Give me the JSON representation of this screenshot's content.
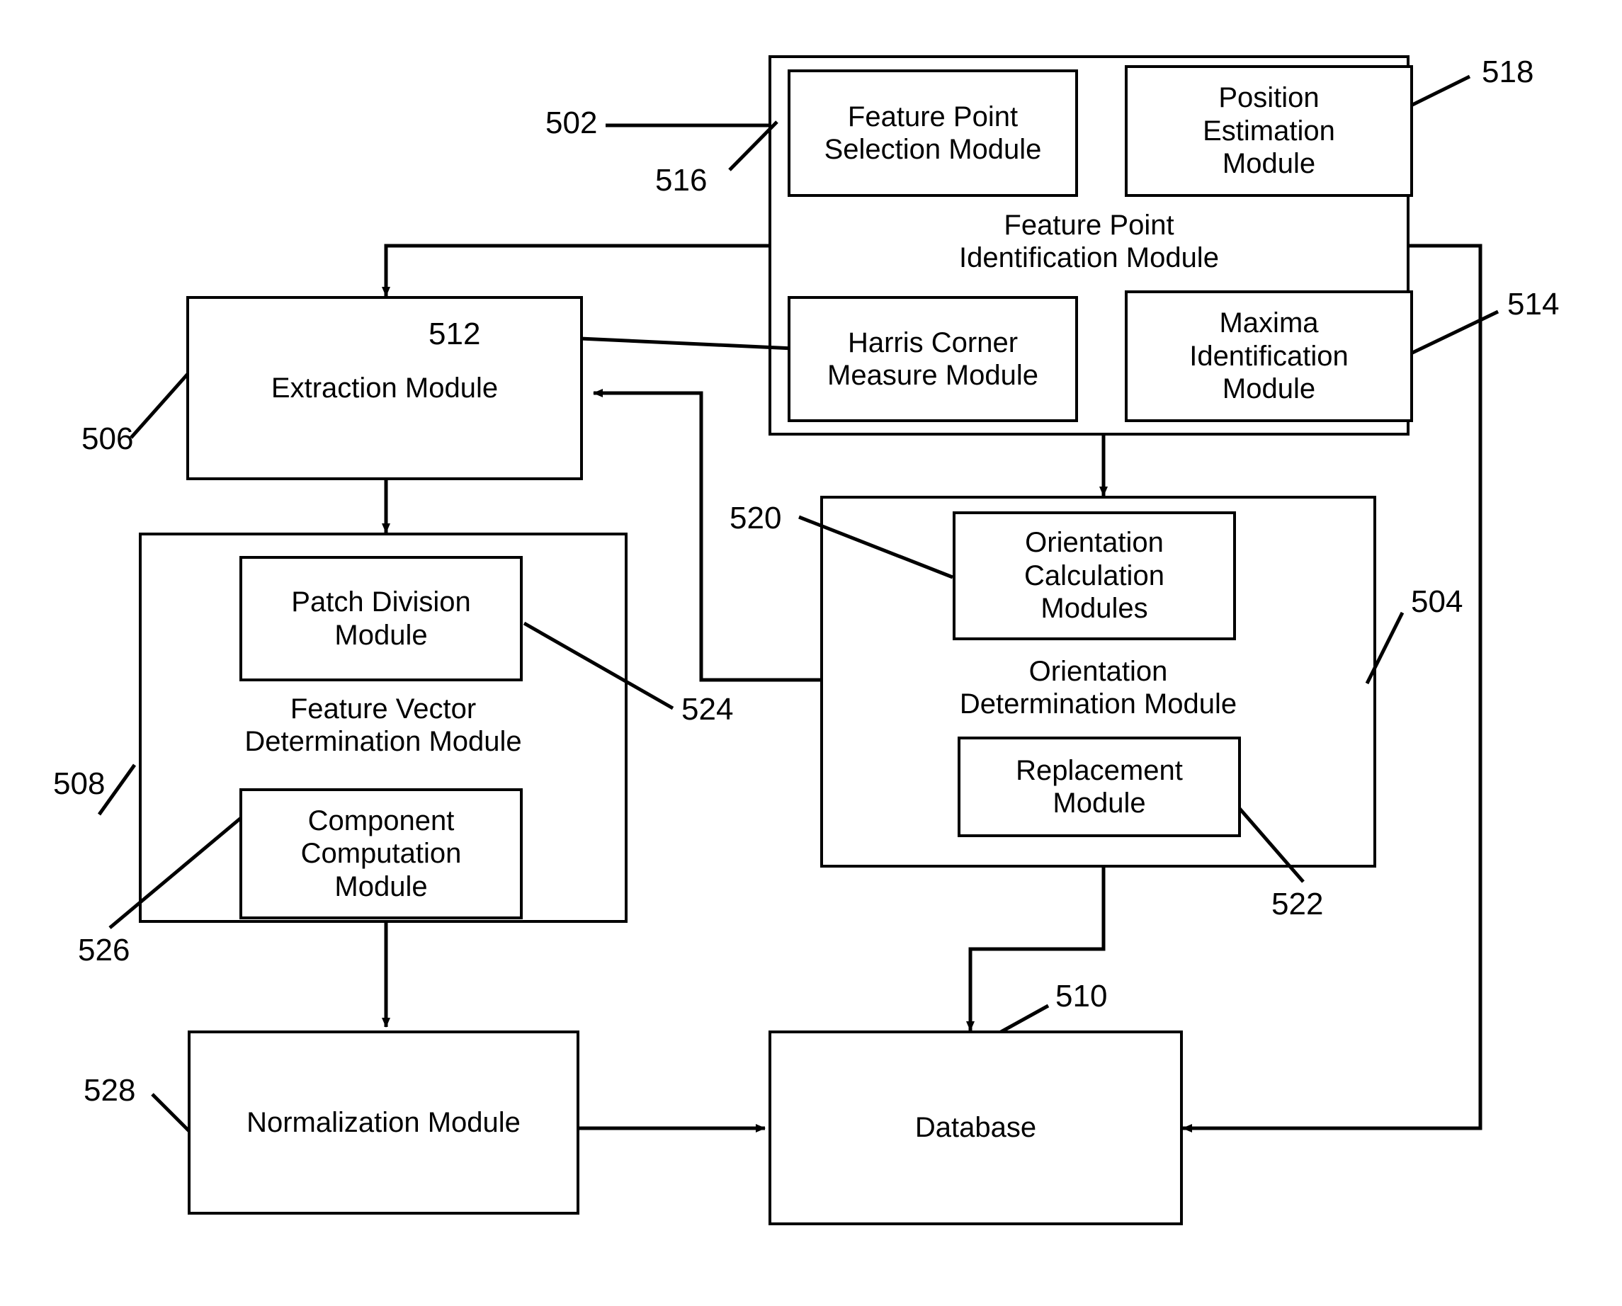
{
  "figure": {
    "kind": "patent-block-diagram",
    "background": "#ffffff",
    "stroke": "#000000"
  },
  "containers": {
    "feature_point_identification": {
      "label": "Feature Point\nIdentification Module",
      "ref": "502"
    },
    "feature_vector_determination": {
      "label": "Feature Vector\nDetermination Module",
      "ref": "508"
    },
    "orientation_determination": {
      "label": "Orientation\nDetermination Module",
      "ref": "504"
    }
  },
  "modules": {
    "feature_point_selection": {
      "label": "Feature Point\nSelection Module",
      "ref": "516"
    },
    "position_estimation": {
      "label": "Position\nEstimation\nModule",
      "ref": "518"
    },
    "harris_corner_measure": {
      "label": "Harris Corner\nMeasure Module",
      "ref": "512"
    },
    "maxima_identification": {
      "label": "Maxima\nIdentification\nModule",
      "ref": "514"
    },
    "extraction": {
      "label": "Extraction Module",
      "ref": "506"
    },
    "patch_division": {
      "label": "Patch Division\nModule",
      "ref": "524"
    },
    "component_computation": {
      "label": "Component\nComputation\nModule",
      "ref": "526"
    },
    "orientation_calculation": {
      "label": "Orientation\nCalculation\nModules",
      "ref": "520"
    },
    "replacement": {
      "label": "Replacement\nModule",
      "ref": "522"
    },
    "normalization": {
      "label": "Normalization Module",
      "ref": "528"
    },
    "database": {
      "label": "Database",
      "ref": "510"
    }
  },
  "reference_numerals": [
    {
      "id": "502",
      "text": "502"
    },
    {
      "id": "516",
      "text": "516"
    },
    {
      "id": "518",
      "text": "518"
    },
    {
      "id": "512",
      "text": "512"
    },
    {
      "id": "514",
      "text": "514"
    },
    {
      "id": "506",
      "text": "506"
    },
    {
      "id": "520",
      "text": "520"
    },
    {
      "id": "524",
      "text": "524"
    },
    {
      "id": "504",
      "text": "504"
    },
    {
      "id": "508",
      "text": "508"
    },
    {
      "id": "526",
      "text": "526"
    },
    {
      "id": "522",
      "text": "522"
    },
    {
      "id": "528",
      "text": "528"
    },
    {
      "id": "510",
      "text": "510"
    }
  ],
  "connections": [
    {
      "from": "feature_point_identification",
      "to": "extraction",
      "type": "arrow"
    },
    {
      "from": "feature_point_identification",
      "to": "orientation_determination",
      "type": "arrow"
    },
    {
      "from": "orientation_determination",
      "to": "extraction",
      "type": "arrow"
    },
    {
      "from": "extraction",
      "to": "feature_vector_determination",
      "type": "arrow"
    },
    {
      "from": "feature_vector_determination",
      "to": "normalization",
      "type": "arrow"
    },
    {
      "from": "normalization",
      "to": "database",
      "type": "arrow"
    },
    {
      "from": "orientation_determination",
      "to": "database",
      "type": "arrow"
    },
    {
      "from": "feature_point_identification",
      "to": "database",
      "type": "arrow"
    }
  ]
}
